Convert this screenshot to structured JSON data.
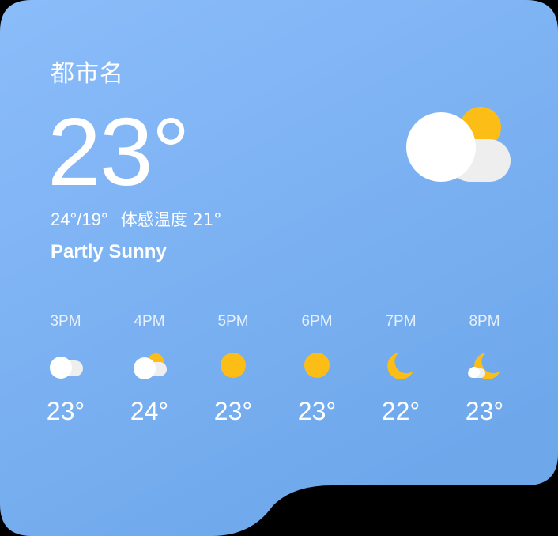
{
  "widget": {
    "city": "都市名",
    "temperature": "23°",
    "range": "24°/19°",
    "feels_like": "体感温度 21°",
    "condition": "Partly Sunny",
    "icon": "partly-sunny-icon",
    "colors": {
      "card_top": "#8bbcfa",
      "card_bottom": "#6fa9ec",
      "sun": "#fcbd16",
      "cloud": "#ffffff",
      "cloud_shade": "#f0f0f0"
    }
  },
  "hourly": [
    {
      "time": "3PM",
      "temp": "23°",
      "icon": "cloudy-icon"
    },
    {
      "time": "4PM",
      "temp": "24°",
      "icon": "partly-sunny-icon"
    },
    {
      "time": "5PM",
      "temp": "23°",
      "icon": "sunny-icon"
    },
    {
      "time": "6PM",
      "temp": "23°",
      "icon": "sunny-icon"
    },
    {
      "time": "7PM",
      "temp": "22°",
      "icon": "moon-icon"
    },
    {
      "time": "8PM",
      "temp": "23°",
      "icon": "moon-cloud-icon"
    }
  ]
}
